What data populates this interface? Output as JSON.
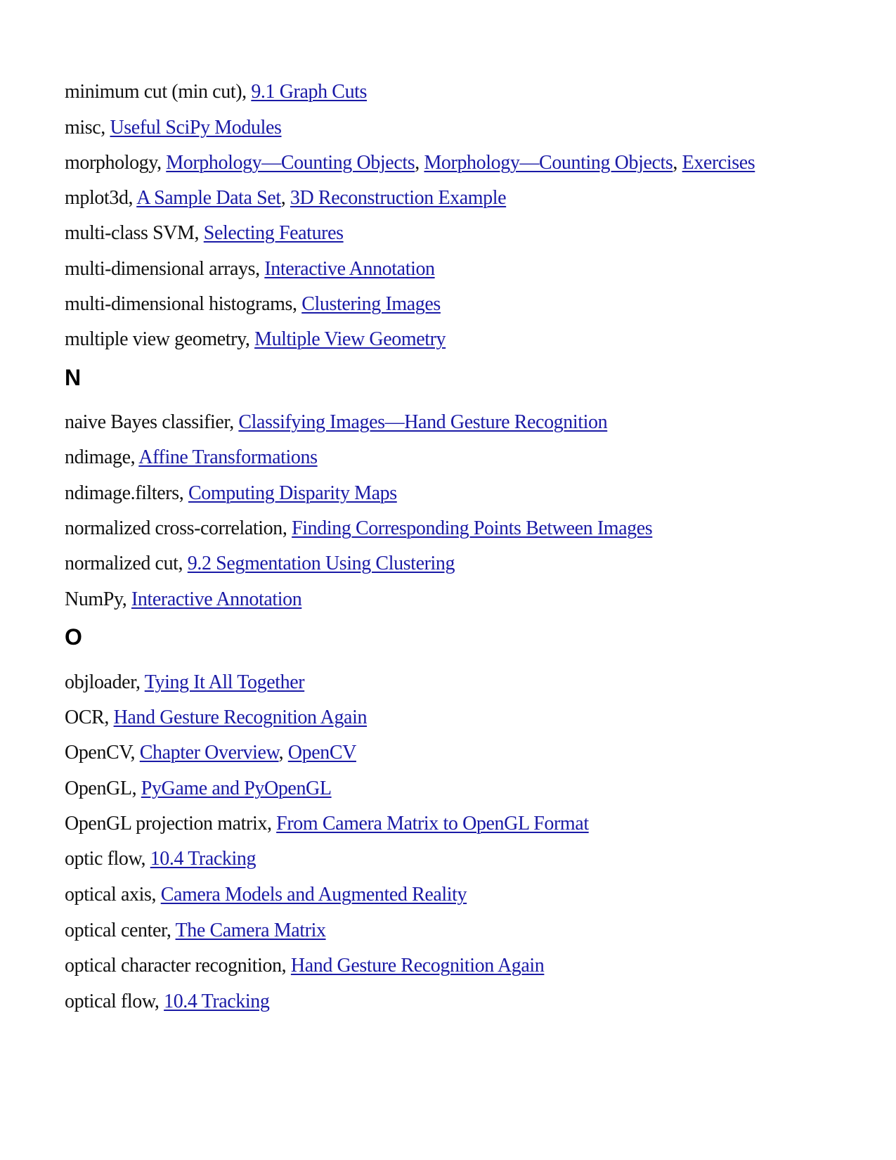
{
  "index": {
    "m_entries": [
      {
        "term": "minimum cut (min cut), ",
        "links": [
          "9.1 Graph Cuts"
        ]
      },
      {
        "term": "misc, ",
        "links": [
          "Useful SciPy Modules"
        ]
      },
      {
        "term": "morphology, ",
        "links": [
          "Morphology—Counting Objects",
          "Morphology—Counting Objects",
          "Exercises"
        ]
      },
      {
        "term": "mplot3d, ",
        "links": [
          "A Sample Data Set",
          "3D Reconstruction Example"
        ]
      },
      {
        "term": "multi-class SVM, ",
        "links": [
          "Selecting Features"
        ]
      },
      {
        "term": "multi-dimensional arrays, ",
        "links": [
          "Interactive Annotation"
        ]
      },
      {
        "term": "multi-dimensional histograms, ",
        "links": [
          "Clustering Images"
        ]
      },
      {
        "term": "multiple view geometry, ",
        "links": [
          "Multiple View Geometry"
        ]
      }
    ],
    "n_heading": "N",
    "n_entries": [
      {
        "term": "naive Bayes classifier, ",
        "links": [
          "Classifying Images—Hand Gesture Recognition"
        ]
      },
      {
        "term": "ndimage, ",
        "links": [
          "Affine Transformations"
        ]
      },
      {
        "term": "ndimage.filters, ",
        "links": [
          "Computing Disparity Maps"
        ]
      },
      {
        "term": "normalized cross-correlation, ",
        "links": [
          "Finding Corresponding Points Between Images"
        ]
      },
      {
        "term": "normalized cut, ",
        "links": [
          "9.2 Segmentation Using Clustering"
        ]
      },
      {
        "term": "NumPy, ",
        "links": [
          "Interactive Annotation"
        ]
      }
    ],
    "o_heading": "O",
    "o_entries": [
      {
        "term": "objloader, ",
        "links": [
          "Tying It All Together"
        ]
      },
      {
        "term": "OCR, ",
        "links": [
          "Hand Gesture Recognition Again"
        ]
      },
      {
        "term": "OpenCV, ",
        "links": [
          "Chapter Overview",
          "OpenCV"
        ]
      },
      {
        "term": "OpenGL, ",
        "links": [
          "PyGame and PyOpenGL"
        ]
      },
      {
        "term": "OpenGL projection matrix, ",
        "links": [
          "From Camera Matrix to OpenGL Format"
        ]
      },
      {
        "term": "optic flow, ",
        "links": [
          "10.4 Tracking"
        ]
      },
      {
        "term": "optical axis, ",
        "links": [
          "Camera Models and Augmented Reality"
        ]
      },
      {
        "term": "optical center, ",
        "links": [
          "The Camera Matrix"
        ]
      },
      {
        "term": "optical character recognition, ",
        "links": [
          "Hand Gesture Recognition Again"
        ]
      },
      {
        "term": "optical flow, ",
        "links": [
          "10.4 Tracking"
        ]
      }
    ],
    "separator": ", "
  }
}
